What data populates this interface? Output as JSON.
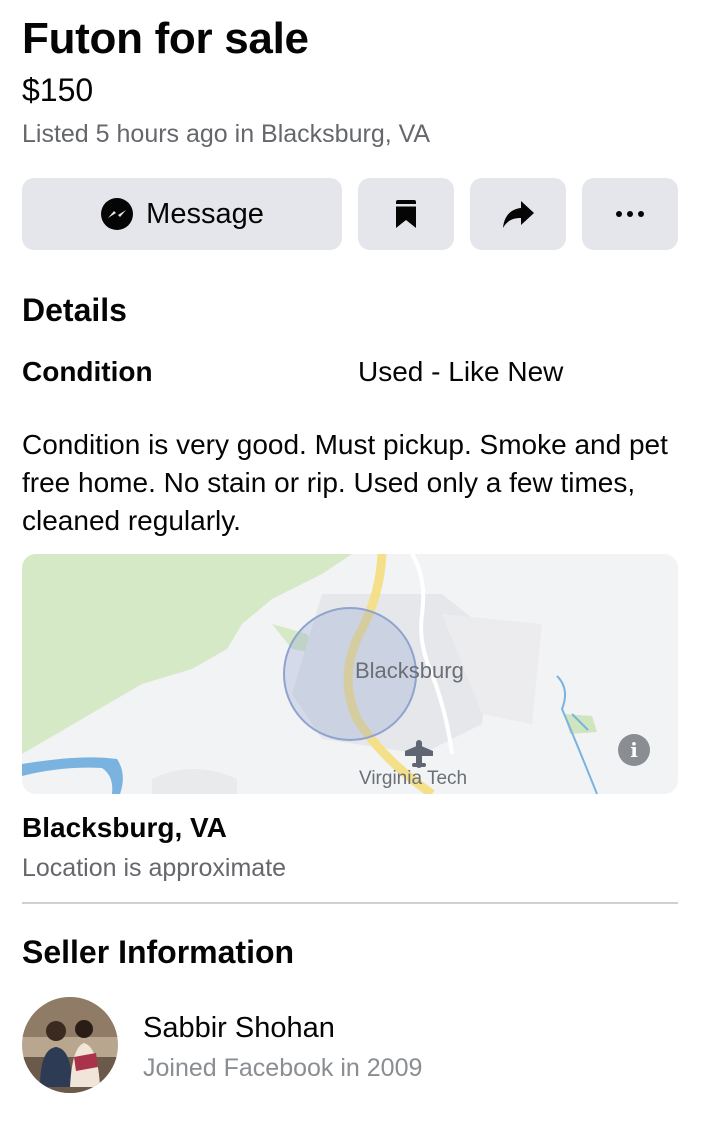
{
  "listing": {
    "title": "Futon for sale",
    "price": "$150",
    "listed_text": "Listed 5 hours ago in Blacksburg, VA"
  },
  "actions": {
    "message_label": "Message",
    "message_icon": "messenger-icon",
    "save_icon": "bookmark-icon",
    "share_icon": "share-icon",
    "more_icon": "more-dots-icon"
  },
  "details": {
    "heading": "Details",
    "condition_label": "Condition",
    "condition_value": "Used - Like New",
    "description": "Condition is very good. Must pickup. Smoke and pet free home. No stain or rip. Used only a few times, cleaned regularly."
  },
  "map": {
    "city_label": "Blacksburg",
    "poi_label": "Virginia Tech",
    "info_icon": "info-icon",
    "info_glyph": "i",
    "colors": {
      "background": "#f2f3f5",
      "park": "#d6e9c6",
      "road": "#f4e08a",
      "water": "#7ab3e0",
      "radius": "#8fa3cf"
    }
  },
  "location": {
    "title": "Blacksburg, VA",
    "subtitle": "Location is approximate"
  },
  "seller": {
    "heading": "Seller Information",
    "name": "Sabbir Shohan",
    "joined": "Joined Facebook in 2009"
  },
  "colors": {
    "button_bg": "#e4e6eb",
    "secondary_text": "#65676b",
    "tertiary_text": "#8a8d91",
    "divider": "#ced0d4"
  }
}
